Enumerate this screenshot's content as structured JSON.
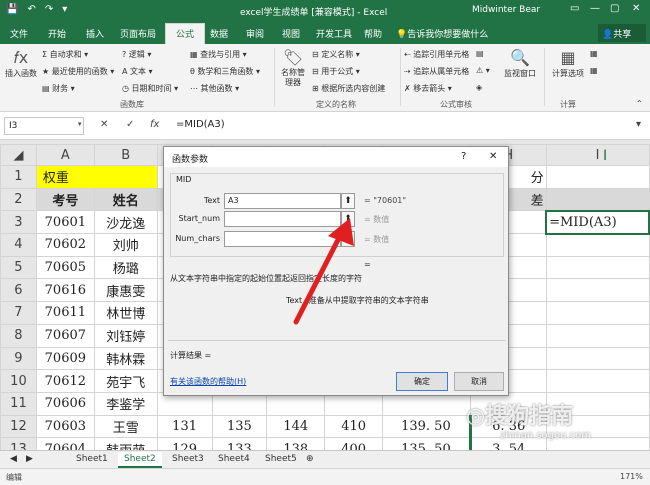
{
  "titlebar": {
    "title": "excel学生成绩单 [兼容模式] - Excel",
    "user": "Midwinter Bear",
    "quick_access": [
      "💾",
      "↶",
      "↷",
      "▾"
    ],
    "window_buttons": [
      "▭",
      "—",
      "▢",
      "✕"
    ]
  },
  "tabs": [
    "文件",
    "开始",
    "插入",
    "页面布局",
    "公式",
    "数据",
    "审阅",
    "视图",
    "开发工具",
    "帮助"
  ],
  "active_tab": "公式",
  "tell_me": "告诉我你想要做什么",
  "share_label": "共享",
  "ribbon": {
    "insert_function": "插入函数",
    "autosum": "自动求和",
    "recent": "最近使用的函数",
    "financial": "财务",
    "logical": "逻辑",
    "text": "文本",
    "datetime": "日期和时间",
    "lookup": "查找与引用",
    "math": "数学和三角函数",
    "more": "其他函数",
    "group_library": "函数库",
    "name_manager": "名称管理器",
    "define_name": "定义名称",
    "use_in_formula": "用于公式",
    "create_from_sel": "根据所选内容创建",
    "group_names": "定义的名称",
    "trace_prec": "追踪引用单元格",
    "trace_dep": "追踪从属单元格",
    "remove_arrows": "移去箭头",
    "group_audit": "公式审核",
    "watch": "监视窗口",
    "calc_options": "计算选项",
    "group_calc": "计算"
  },
  "formula_bar": {
    "name_box": "I3",
    "cancel": "✕",
    "enter": "✓",
    "fx": "fx",
    "formula": "=MID(A3)"
  },
  "sheet": {
    "columns": [
      "A",
      "B",
      "C",
      "D",
      "E",
      "F",
      "G",
      "H",
      "I"
    ],
    "row1": {
      "num": "1",
      "a": "权重",
      "h": "分"
    },
    "row2": {
      "num": "2",
      "a": "考号",
      "b": "姓名",
      "h": "差"
    },
    "active_cell_value": "=MID(A3)",
    "rows": [
      {
        "num": "3",
        "a": "70601",
        "b": "沙龙逸",
        "c": "",
        "d": "",
        "e": "",
        "f": "",
        "g": ""
      },
      {
        "num": "4",
        "a": "70602",
        "b": "刘帅",
        "c": "",
        "d": "",
        "e": "",
        "f": "",
        "g": ""
      },
      {
        "num": "5",
        "a": "70605",
        "b": "杨璐",
        "c": "",
        "d": "",
        "e": "",
        "f": "",
        "g": ""
      },
      {
        "num": "6",
        "a": "70616",
        "b": "康惠雯",
        "c": "",
        "d": "",
        "e": "",
        "f": "",
        "g": ""
      },
      {
        "num": "7",
        "a": "70611",
        "b": "林世博",
        "c": "",
        "d": "",
        "e": "",
        "f": "",
        "g": ""
      },
      {
        "num": "8",
        "a": "70607",
        "b": "刘钰婷",
        "c": "",
        "d": "",
        "e": "",
        "f": "",
        "g": ""
      },
      {
        "num": "9",
        "a": "70609",
        "b": "韩林霖",
        "c": "",
        "d": "",
        "e": "",
        "f": "",
        "g": ""
      },
      {
        "num": "10",
        "a": "70612",
        "b": "苑宇飞",
        "c": "",
        "d": "",
        "e": "",
        "f": "",
        "g": ""
      },
      {
        "num": "11",
        "a": "70606",
        "b": "李鉴学",
        "c": "",
        "d": "",
        "e": "",
        "f": "",
        "g": ""
      },
      {
        "num": "12",
        "a": "70603",
        "b": "王雪",
        "c": "131",
        "d": "135",
        "e": "144",
        "f": "410",
        "g": "139. 50",
        "h": "6. 36"
      },
      {
        "num": "13",
        "a": "70604",
        "b": "韩雨萌",
        "c": "129",
        "d": "133",
        "e": "138",
        "f": "400",
        "g": "135. 50",
        "h": "3. 54"
      }
    ]
  },
  "dialog": {
    "title": "函数参数",
    "help_btn": "?",
    "close_btn": "✕",
    "function_name": "MID",
    "args": [
      {
        "label": "Text",
        "value": "A3",
        "result": "= \"70601\""
      },
      {
        "label": "Start_num",
        "value": "",
        "result": "= 数值"
      },
      {
        "label": "Num_chars",
        "value": "",
        "result": "= 数值"
      }
    ],
    "equals": "=",
    "description": "从文本字符串中指定的起始位置起返回指定长度的字符",
    "arg_description_label": "Text",
    "arg_description": "准备从中提取字符串的文本字符串",
    "calc_result_label": "计算结果 =",
    "help_link": "有关该函数的帮助(H)",
    "ok_label": "确定",
    "cancel_label": "取消"
  },
  "sheet_tabs": [
    "Sheet1",
    "Sheet2",
    "Sheet3",
    "Sheet4",
    "Sheet5"
  ],
  "active_sheet": "Sheet2",
  "status": {
    "mode": "编辑",
    "zoom": "171%"
  },
  "watermark": "搜狗指南",
  "watermark_url": "zhinan.sogou.com",
  "colors": {
    "excel_green": "#217346",
    "header_yellow": "#ffff00",
    "arrow_red": "#e02020"
  }
}
